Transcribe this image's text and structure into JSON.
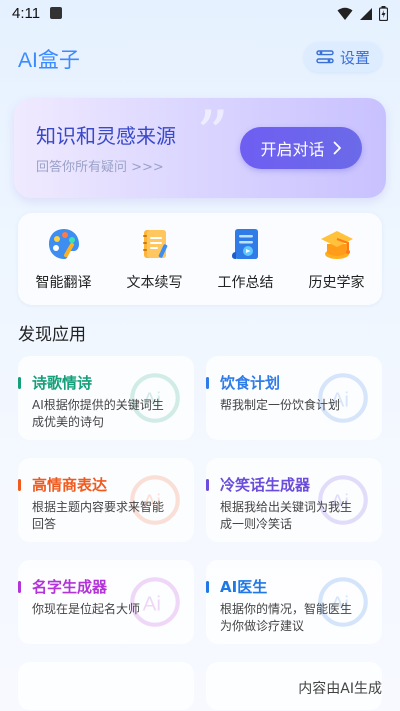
{
  "status_bar": {
    "time": "4:11"
  },
  "header": {
    "brand": "AI盒子",
    "settings_label": "设置"
  },
  "hero": {
    "title": "知识和灵感来源",
    "subtitle": "回答你所有疑问 >>>",
    "cta_label": "开启对话"
  },
  "tools": [
    {
      "label": "智能翻译",
      "icon": "palette-icon"
    },
    {
      "label": "文本续写",
      "icon": "notebook-icon"
    },
    {
      "label": "工作总结",
      "icon": "summary-icon"
    },
    {
      "label": "历史学家",
      "icon": "grad-cap-icon"
    }
  ],
  "section": {
    "title": "发现应用"
  },
  "apps": [
    {
      "name": "诗歌情诗",
      "desc": "AI根据你提供的关键词生成优美的诗句",
      "color": "#16a07a"
    },
    {
      "name": "饮食计划",
      "desc": "帮我制定一份饮食计划",
      "color": "#2f7be8"
    },
    {
      "name": "高情商表达",
      "desc": "根据主题内容要求来智能回答",
      "color": "#f05a1e"
    },
    {
      "name": "冷笑话生成器",
      "desc": "根据我给出关键词为我生成一则冷笑话",
      "color": "#6b4cdc"
    },
    {
      "name": "名字生成器",
      "desc": "你现在是位起名大师",
      "color": "#b233d8"
    },
    {
      "name": "AI医生",
      "desc": "根据你的情况，智能医生为你做诊疗建议",
      "color": "#1f78e6"
    }
  ],
  "footer": {
    "note": "内容由AI生成"
  }
}
